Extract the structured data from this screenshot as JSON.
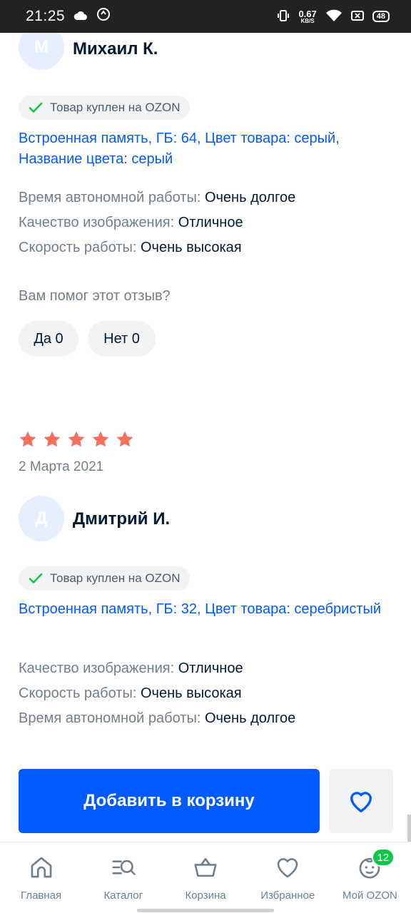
{
  "status_bar": {
    "time": "21:25",
    "net_speed_value": "0.67",
    "net_speed_unit": "KB/S",
    "battery": "48",
    "icons": [
      "cloud-icon",
      "sync-icon",
      "vibrate-icon",
      "wifi-icon",
      "screen-icon",
      "battery-icon"
    ]
  },
  "reviews": [
    {
      "avatar_letter": "М",
      "name": "Михаил К.",
      "badge": "Товар куплен на OZON",
      "variant": "Встроенная память, ГБ: 64, Цвет товара: серый, Название цвета: серый",
      "attributes": [
        {
          "key": "Время автономной работы:",
          "value": "Очень долгое"
        },
        {
          "key": "Качество изображения:",
          "value": "Отличное"
        },
        {
          "key": "Скорость работы:",
          "value": "Очень высокая"
        }
      ],
      "helpful_question": "Вам помог этот отзыв?",
      "yes_label": "Да 0",
      "no_label": "Нет 0"
    },
    {
      "rating": 5,
      "date": "2 Марта 2021",
      "avatar_letter": "Д",
      "name": "Дмитрий И.",
      "badge": "Товар куплен на OZON",
      "variant": "Встроенная память, ГБ: 32, Цвет товара: серебристый",
      "attributes": [
        {
          "key": "Качество изображения:",
          "value": "Отличное"
        },
        {
          "key": "Скорость работы:",
          "value": "Очень высокая"
        },
        {
          "key": "Время автономной работы:",
          "value": "Очень долгое"
        }
      ]
    }
  ],
  "actions": {
    "add_to_cart": "Добавить в корзину"
  },
  "bottom_nav": [
    {
      "label": "Главная",
      "icon": "home-icon"
    },
    {
      "label": "Каталог",
      "icon": "catalog-search-icon"
    },
    {
      "label": "Корзина",
      "icon": "basket-icon"
    },
    {
      "label": "Избранное",
      "icon": "heart-icon"
    },
    {
      "label": "Мой OZON",
      "icon": "profile-face-icon",
      "badge": "12"
    }
  ],
  "colors": {
    "brand_blue": "#005bff",
    "star": "#f56f5b",
    "check_green": "#10c44c",
    "muted_text": "#707f8d"
  }
}
